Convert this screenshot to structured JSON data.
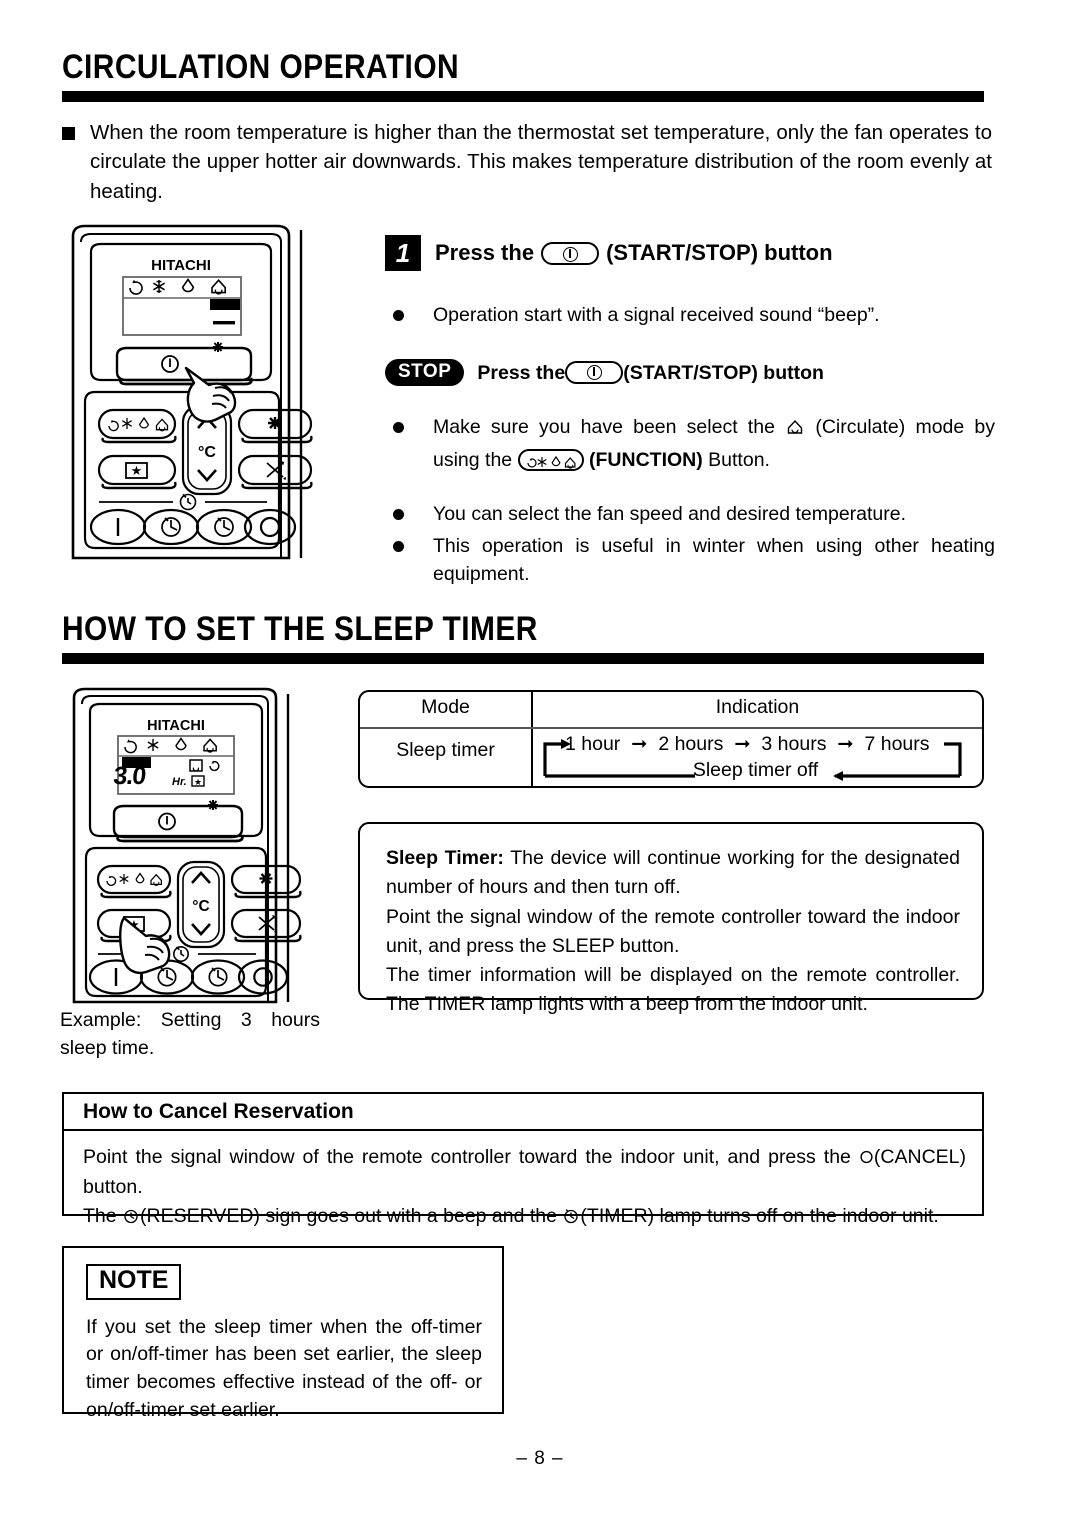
{
  "sections": {
    "circulation": {
      "heading": "CIRCULATION OPERATION",
      "intro": "When the room temperature is higher than the thermostat set temperature, only the fan operates to circulate the upper hotter air downwards. This makes temperature distribution of the room evenly at heating.",
      "step": {
        "number": "1",
        "press_the": "Press the",
        "button_label": "(START/STOP) button",
        "bullet_start": "Operation start with a signal received sound “beep”.",
        "stop_tag": "STOP",
        "stop_press_the": "Press the",
        "stop_button_label": "(START/STOP) button"
      },
      "bullets": {
        "b1_pre": "Make sure you have been select the",
        "b1_mid": "(Circulate) mode by using the",
        "b1_bold": "(FUNCTION)",
        "b1_post": "Button.",
        "b2": "You can select the fan speed and desired temperature.",
        "b3": "This operation is useful in winter when using other heating equipment."
      }
    },
    "sleep_timer": {
      "heading": "HOW TO SET THE SLEEP TIMER",
      "table": {
        "col_mode": "Mode",
        "col_indication": "Indication",
        "row_mode": "Sleep timer",
        "cycle_steps": [
          "1 hour",
          "2 hours",
          "3 hours",
          "7 hours"
        ],
        "cycle_off": "Sleep timer off"
      },
      "description": {
        "title": "Sleep Timer:",
        "line1": " The device will continue working for the designated number of hours and then turn off.",
        "line2": "Point the signal window of the remote controller toward the indoor unit, and press the SLEEP button.",
        "line3": "The timer information will be displayed on the remote controller. The TIMER lamp lights with a beep from the indoor unit."
      },
      "example_caption": "Example: Setting 3 hours sleep time."
    },
    "cancel": {
      "heading": "How to Cancel Reservation",
      "line1_pre": "Point the signal window of the remote controller toward the indoor unit, and press the",
      "line1_post": "(CANCEL) button.",
      "line2_pre": "The",
      "line2_mid": "(RESERVED) sign goes out with a beep and the",
      "line2_post": "(TIMER) lamp turns off on the indoor unit."
    },
    "note": {
      "tag": "NOTE",
      "text": "If you set the sleep timer when the off-timer or on/off-timer has been set earlier, the sleep timer becomes effective instead of the off- or on/off-timer set earlier."
    }
  },
  "remote": {
    "brand": "HITACHI",
    "temp_unit": "°C",
    "lcd_value": "3.0",
    "lcd_unit": "Hr.",
    "mode_icons": [
      "auto-icon",
      "snowflake-icon",
      "dehumidify-icon",
      "circulate-icon"
    ],
    "selected_mode_top": "circulate-icon",
    "selected_mode_bottom": "auto-icon"
  },
  "footer": {
    "page_number": "– 8 –"
  },
  "colors": {
    "ink": "#000000",
    "paper": "#ffffff",
    "rule": "#555555"
  }
}
